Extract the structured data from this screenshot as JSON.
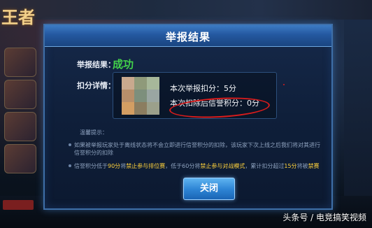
{
  "game": {
    "logo_text": "王者"
  },
  "dialog": {
    "title": "举报结果",
    "result_label": "举报结果：",
    "result_value": "成功",
    "detail_label": "扣分详情：",
    "detail_line1": "本次举报扣分：5分",
    "detail_line2": "本次扣除后信誉积分：0分",
    "tips_title": "温馨提示：",
    "tip1_part1": "如果被举报玩家处于离线状态将不会立即进行信誉积分的扣除，该玩家下次上线之后我们将对其进行",
    "tip1_part2": "信誉积分的扣除",
    "tip2_a": "信誉积分低于",
    "tip2_b": "90分",
    "tip2_c": "将",
    "tip2_d": "禁止参与排位赛",
    "tip2_e": "，低于60分将",
    "tip2_f": "禁止参与对战模式",
    "tip2_g": "，累计扣分超过",
    "tip2_h": "15分",
    "tip2_i": "将被",
    "tip2_j": "禁赛",
    "close_button": "关闭"
  },
  "watermark": "头条号 / 电竞搞笑视频",
  "colors": {
    "success_green": "#42d24a",
    "highlight_yellow": "#ffd23c",
    "annotation_red": "#d81c1c",
    "dialog_border": "#3e6fa8"
  }
}
